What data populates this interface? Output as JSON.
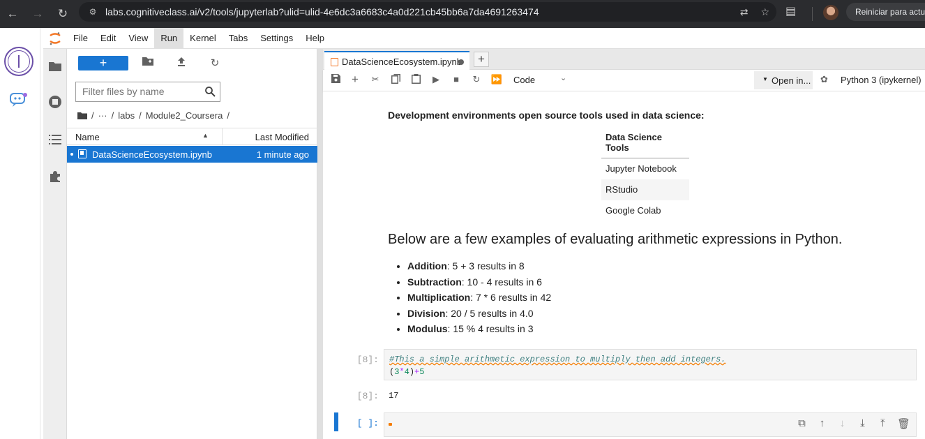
{
  "browser": {
    "url": "labs.cognitiveclass.ai/v2/tools/jupyterlab?ulid=ulid-4e6dc3a6683c4a0d221cb45bb6a7da4691263474",
    "update_button": "Reiniciar para actua"
  },
  "menubar": {
    "items": [
      "File",
      "Edit",
      "View",
      "Run",
      "Kernel",
      "Tabs",
      "Settings",
      "Help"
    ],
    "active": "Run"
  },
  "filebrowser": {
    "new_label": "+",
    "filter_placeholder": "Filter files by name",
    "breadcrumb": {
      "root": "/",
      "ellipsis": "···",
      "sep1": "/",
      "folder1": "labs",
      "sep2": "/",
      "folder2": "Module2_Coursera",
      "sep3": "/"
    },
    "columns": {
      "name": "Name",
      "modified": "Last Modified"
    },
    "files": [
      {
        "name": "DataScienceEcosystem.ipynb",
        "modified": "1 minute ago",
        "selected": true
      }
    ]
  },
  "notebook": {
    "tab_label": "DataScienceEcosystem.ipynb",
    "add_tab": "+",
    "cell_type": "Code",
    "open_in": "Open in...",
    "kernel": "Python 3 (ipykernel)",
    "md_text": "Development environments open source tools used in data science:",
    "table": {
      "header": "Data Science Tools",
      "rows": [
        "Jupyter Notebook",
        "RStudio",
        "Google Colab"
      ]
    },
    "heading": "Below are a few examples of evaluating arithmetic expressions in Python.",
    "examples": [
      {
        "term": "Addition",
        "text": ": 5 + 3 results in 8"
      },
      {
        "term": "Subtraction",
        "text": ": 10 - 4 results in 6"
      },
      {
        "term": "Multiplication",
        "text": ": 7 * 6 results in 42"
      },
      {
        "term": "Division",
        "text": ": 20 / 5 results in 4.0"
      },
      {
        "term": "Modulus",
        "text": ": 15 % 4 results in 3"
      }
    ],
    "code_cell": {
      "prompt": "[8]:",
      "comment": "#This a simple arithmetic expression to multiply then add integers.",
      "code_parts": {
        "p1": "(",
        "n1": "3",
        "op1": "*",
        "n2": "4",
        "p2": ")",
        "op2": "+",
        "n3": "5"
      }
    },
    "output": {
      "prompt": "[8]:",
      "text": "17"
    },
    "empty_cell": {
      "prompt": "[ ]:"
    }
  },
  "colors": {
    "accent": "#1976d2",
    "jupyter_orange": "#f37726"
  }
}
